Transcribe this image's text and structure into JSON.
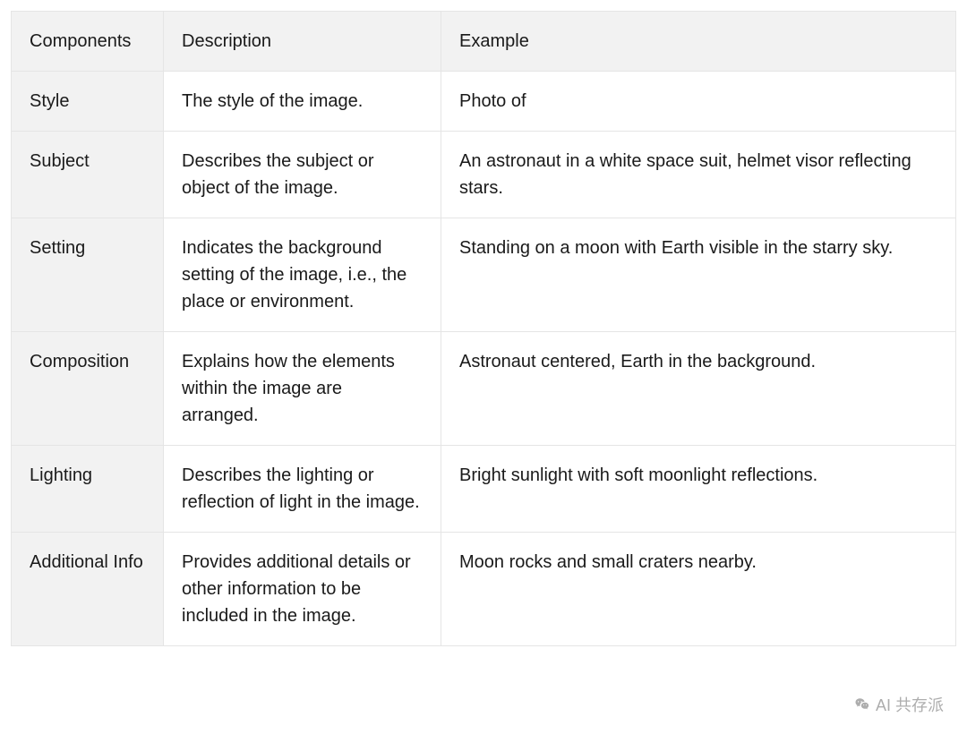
{
  "table": {
    "headers": [
      "Components",
      "Description",
      "Example"
    ],
    "rows": [
      {
        "component": "Style",
        "description": "The style of the image.",
        "example": "Photo of"
      },
      {
        "component": "Subject",
        "description": "Describes the subject or object of the image.",
        "example": "An astronaut in a white space suit, helmet visor reflecting stars."
      },
      {
        "component": "Setting",
        "description": "Indicates the background setting of the image, i.e., the place or environment.",
        "example": "Standing on a moon with Earth visible in the starry sky."
      },
      {
        "component": "Composition",
        "description": "Explains how the elements within the image are arranged.",
        "example": "Astronaut centered, Earth in the background."
      },
      {
        "component": "Lighting",
        "description": "Describes the lighting or reflection of light in the image.",
        "example": "Bright sunlight with soft moonlight reflections."
      },
      {
        "component": "Additional Info",
        "description": "Provides additional details or other information to be included in the image.",
        "example": "Moon rocks and small craters nearby."
      }
    ]
  },
  "watermark": {
    "text": "AI 共存派"
  }
}
